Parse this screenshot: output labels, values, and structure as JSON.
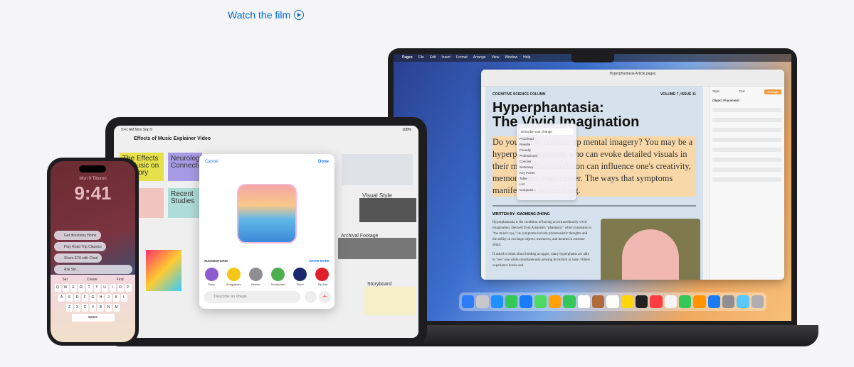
{
  "link": {
    "label": "Watch the film",
    "icon": "play-circle-icon",
    "color": "#0066cc"
  },
  "mac": {
    "menubar": [
      "Pages",
      "File",
      "Edit",
      "Insert",
      "Format",
      "Arrange",
      "View",
      "Window",
      "Help"
    ],
    "window_title": "Hyperphantasia Article.pages",
    "doc": {
      "kicker": "COGNITIVE SCIENCE COLUMN",
      "issue": "VOLUME 7, ISSUE 11",
      "title_line1": "Hyperphantasia:",
      "title_line2": "The Vivid Imagination",
      "lede": "Do you easily conjure up mental imagery? You may be a hyperphant, a person who can evoke detailed visuals in their mind. This condition can influence one's creativity, memory, and even career. The ways that symptoms manifest are astonishing.",
      "byline": "WRITTEN BY: XIAOMENG ZHONG",
      "body1": "Hyperphantasia is the condition of having an extraordinarily vivid imagination. Derived from Aristotle's \"phantasia,\" which translates to \"the mind's eye,\" its symptoms include photorealistic thoughts and the ability to envisage objects, memories, and dreams in extreme detail.",
      "body2": "If asked to think about holding an apple, many hyperphants are able to \"see\" one while simultaneously sensing its texture or taste. Others experience books and"
    },
    "inspector": {
      "tabs": [
        "Style",
        "Text",
        "Arrange"
      ],
      "section": "Object Placement"
    },
    "popover": {
      "items": [
        "Describe your change",
        "Proofread",
        "Rewrite",
        "Friendly",
        "Professional",
        "Concise",
        "Summary",
        "Key Points",
        "Table",
        "List",
        "Compose..."
      ]
    }
  },
  "ipad": {
    "status_time": "9:41 AM  Mon Sep 9",
    "battery": "100%",
    "board_title": "Effects of Music Explainer Video",
    "cards": [
      "The Effects of Music on Memory",
      "Neurological Connections",
      "Recent Studies",
      "Visual Style",
      "Archival Footage",
      "Storyboard"
    ],
    "dialog": {
      "cancel": "Cancel",
      "done": "Done",
      "suggestions_label": "SUGGESTIONS",
      "show_more": "SHOW MORE",
      "suggestions": [
        "Party",
        "Sunglasses",
        "Beanie",
        "Snowboard",
        "Disco",
        "Top Hat"
      ],
      "placeholder": "Describe an image"
    }
  },
  "iphone": {
    "date": "Mon 9  Tiburon",
    "time": "9:41",
    "siri_suggestions": [
      "Get directions Home",
      "Play Road Trip Classics",
      "Share ETA with Chad"
    ],
    "siri_placeholder": "Ask Siri...",
    "keyboard_suggest": [
      "Set",
      "Create",
      "Find"
    ],
    "keyboard_rows": [
      [
        "Q",
        "W",
        "E",
        "R",
        "T",
        "Y",
        "U",
        "I",
        "O",
        "P"
      ],
      [
        "A",
        "S",
        "D",
        "F",
        "G",
        "H",
        "J",
        "K",
        "L"
      ],
      [
        "Z",
        "X",
        "C",
        "V",
        "B",
        "N",
        "M"
      ]
    ],
    "space": "space"
  }
}
